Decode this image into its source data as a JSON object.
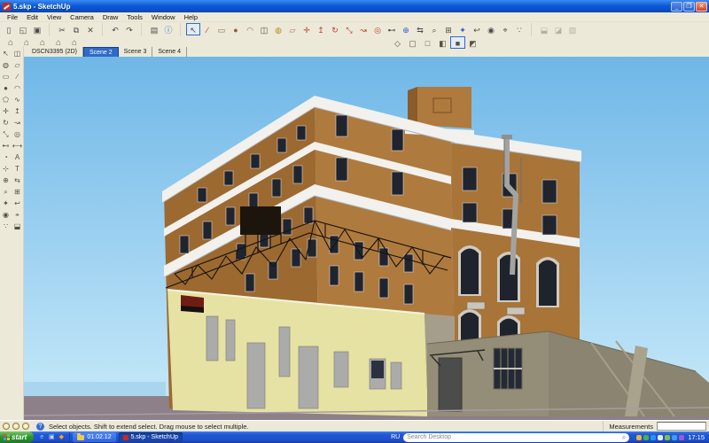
{
  "window": {
    "title": "5.skp - SketchUp",
    "buttons": [
      "minimize",
      "restore",
      "close"
    ]
  },
  "menu": {
    "items": [
      "File",
      "Edit",
      "View",
      "Camera",
      "Draw",
      "Tools",
      "Window",
      "Help"
    ]
  },
  "toolbar_main": {
    "groups": [
      {
        "items": [
          {
            "name": "new",
            "glyph": "▯"
          },
          {
            "name": "open",
            "glyph": "◱"
          },
          {
            "name": "save",
            "glyph": "▣"
          }
        ]
      },
      {
        "items": [
          {
            "name": "cut",
            "glyph": "✂"
          },
          {
            "name": "copy",
            "glyph": "⧉"
          },
          {
            "name": "erase",
            "glyph": "✕"
          }
        ]
      },
      {
        "items": [
          {
            "name": "undo",
            "glyph": "↶"
          },
          {
            "name": "redo",
            "glyph": "↷"
          }
        ]
      },
      {
        "items": [
          {
            "name": "print",
            "glyph": "▤"
          },
          {
            "name": "model-info",
            "glyph": "ⓘ",
            "color": "#2b5fd0"
          }
        ]
      },
      {
        "items": [
          {
            "name": "select",
            "glyph": "↖",
            "pressed": true
          },
          {
            "name": "line",
            "glyph": "∕",
            "color": "#b03020"
          },
          {
            "name": "rectangle",
            "glyph": "▭",
            "color": "#8B5E3C"
          },
          {
            "name": "circle",
            "glyph": "●",
            "color": "#8B5E3C"
          },
          {
            "name": "arc",
            "glyph": "◠",
            "color": "#8B5E3C"
          },
          {
            "name": "make-component",
            "glyph": "◫"
          },
          {
            "name": "paint-bucket",
            "glyph": "◍",
            "color": "#b08a20"
          },
          {
            "name": "eraser",
            "glyph": "▱",
            "color": "#b06a8a"
          },
          {
            "name": "move",
            "glyph": "✛",
            "color": "#c03a2a"
          },
          {
            "name": "push-pull",
            "glyph": "↥",
            "color": "#c03a2a"
          },
          {
            "name": "rotate",
            "glyph": "↻",
            "color": "#c03a2a"
          },
          {
            "name": "scale",
            "glyph": "⤡",
            "color": "#c03a2a"
          },
          {
            "name": "follow-me",
            "glyph": "↝",
            "color": "#c03a2a"
          },
          {
            "name": "offset",
            "glyph": "◎",
            "color": "#c03a2a"
          },
          {
            "name": "tape-measure",
            "glyph": "⊷"
          },
          {
            "name": "orbit",
            "glyph": "⊕",
            "color": "#2b5fd0"
          },
          {
            "name": "pan",
            "glyph": "⇆"
          },
          {
            "name": "zoom",
            "glyph": "⌕"
          },
          {
            "name": "zoom-window",
            "glyph": "⊞"
          },
          {
            "name": "zoom-extents",
            "glyph": "✦",
            "color": "#2b5fd0"
          },
          {
            "name": "previous-view",
            "glyph": "↩"
          },
          {
            "name": "position-camera",
            "glyph": "◉"
          },
          {
            "name": "look-around",
            "glyph": "⌖"
          },
          {
            "name": "walk",
            "glyph": "∵"
          }
        ]
      },
      {
        "items": [
          {
            "name": "section-plane",
            "glyph": "⬓",
            "disabled": true
          },
          {
            "name": "section-cuts",
            "glyph": "◪",
            "disabled": true
          },
          {
            "name": "section-display",
            "glyph": "▨",
            "disabled": true
          }
        ]
      }
    ]
  },
  "toolbar_views": {
    "items": [
      {
        "name": "iso-view",
        "glyph": "⌂"
      },
      {
        "name": "top-view",
        "glyph": "⌂"
      },
      {
        "name": "front-view",
        "glyph": "⌂"
      },
      {
        "name": "right-view",
        "glyph": "⌂"
      },
      {
        "name": "back-view",
        "glyph": "⌂"
      }
    ]
  },
  "toolbar_face_styles": {
    "items": [
      {
        "name": "xray-style",
        "glyph": "◇"
      },
      {
        "name": "wireframe-style",
        "glyph": "▢"
      },
      {
        "name": "hidden-line-style",
        "glyph": "□"
      },
      {
        "name": "shaded-style",
        "glyph": "◧"
      },
      {
        "name": "shaded-textures-style",
        "glyph": "■",
        "pressed": true
      },
      {
        "name": "monochrome-style",
        "glyph": "◩"
      }
    ]
  },
  "scene_tabs": {
    "tabs": [
      {
        "label": "DSCN3395 (2D)",
        "active": false
      },
      {
        "label": "Scene 2",
        "active": true
      },
      {
        "label": "Scene 3",
        "active": false
      },
      {
        "label": "Scene 4",
        "active": false
      }
    ]
  },
  "tool_palette": {
    "rows": [
      [
        {
          "name": "select",
          "glyph": "↖"
        },
        {
          "name": "make-component",
          "glyph": "◫"
        }
      ],
      [
        {
          "name": "paint-bucket",
          "glyph": "◍"
        },
        {
          "name": "eraser",
          "glyph": "▱"
        }
      ],
      [
        {
          "name": "rectangle",
          "glyph": "▭"
        },
        {
          "name": "line",
          "glyph": "∕"
        }
      ],
      [
        {
          "name": "circle",
          "glyph": "●"
        },
        {
          "name": "arc",
          "glyph": "◠"
        }
      ],
      [
        {
          "name": "polygon",
          "glyph": "⬠"
        },
        {
          "name": "freehand",
          "glyph": "∿"
        }
      ],
      [
        {
          "name": "move",
          "glyph": "✛"
        },
        {
          "name": "push-pull",
          "glyph": "↥"
        }
      ],
      [
        {
          "name": "rotate",
          "glyph": "↻"
        },
        {
          "name": "follow-me",
          "glyph": "↝"
        }
      ],
      [
        {
          "name": "scale",
          "glyph": "⤡"
        },
        {
          "name": "offset",
          "glyph": "◎"
        }
      ],
      [
        {
          "name": "tape-measure",
          "glyph": "⊷"
        },
        {
          "name": "dimension",
          "glyph": "⟷"
        }
      ],
      [
        {
          "name": "protractor",
          "glyph": "◔"
        },
        {
          "name": "text",
          "glyph": "A"
        }
      ],
      [
        {
          "name": "axes",
          "glyph": "⊹"
        },
        {
          "name": "3d-text",
          "glyph": "T"
        }
      ],
      [
        {
          "name": "orbit",
          "glyph": "⊕"
        },
        {
          "name": "pan",
          "glyph": "⇆"
        }
      ],
      [
        {
          "name": "zoom",
          "glyph": "⌕"
        },
        {
          "name": "zoom-window",
          "glyph": "⊞"
        }
      ],
      [
        {
          "name": "zoom-extents",
          "glyph": "✦"
        },
        {
          "name": "previous-view",
          "glyph": "↩"
        }
      ],
      [
        {
          "name": "position-camera",
          "glyph": "◉"
        },
        {
          "name": "look-around",
          "glyph": "⌖"
        }
      ],
      [
        {
          "name": "walk",
          "glyph": "∵"
        },
        {
          "name": "section-plane",
          "glyph": "⬓"
        }
      ]
    ]
  },
  "viewport": {
    "description": "3D SketchUp model of a five-story brick building with white cornice bands, pale-yellow ground floor, steel fire-escape canopy, rooftop penthouse, metal flue pipe and low gray concrete annex, against sky and water horizon",
    "colors": {
      "sky_top": "#6FB7E8",
      "sky_bottom": "#C9EAF9",
      "water_left": "#A9D6EE",
      "water_right": "#4C8FCB",
      "ground": "#8D8089",
      "curb": "#A79BA3",
      "brick_left": "#9C6931",
      "brick_mid": "#AF7A3E",
      "brick_right": "#A87438",
      "brick_dark": "#8A5C2B",
      "cornice": "#F2F1ED",
      "cornice_shade": "#AEB4BC",
      "yellow_wall": "#E6E2A3",
      "annex_front": "#948D78",
      "annex_right": "#8B8470",
      "annex_streak": "#A59E89",
      "window_dark": "#20242E",
      "window_trim": "#CFCBC2",
      "gray_panel": "#ABABA9",
      "steel_frame": "#17130E",
      "pipe": "#A3A3A1",
      "awning_red": "#6E1D15",
      "door_dark": "#4C4C4A",
      "corner_strip": "#A59E8C"
    }
  },
  "status_bar": {
    "circle_icons": [
      "geo-location",
      "claim-credit",
      "sign-in"
    ],
    "help_text": "Select objects. Shift to extend select. Drag mouse to select multiple.",
    "measurements_label": "Measurements"
  },
  "taskbar": {
    "start_label": "start",
    "quick_launch": [
      {
        "name": "internet-explorer",
        "glyph": "e",
        "color": "#7fd4ff"
      },
      {
        "name": "desktop",
        "glyph": "▣",
        "color": "#cfd8e8"
      },
      {
        "name": "media-app",
        "glyph": "◆",
        "color": "#f5a623"
      }
    ],
    "buttons": [
      {
        "label": "01.02.12",
        "icon": "folder",
        "active": false
      },
      {
        "label": "5.skp - SketchUp",
        "icon": "sketchup",
        "active": true
      }
    ],
    "language": "RU",
    "search_placeholder": "Search Desktop",
    "tray_icons": [
      {
        "name": "tray-antivirus",
        "color": "#E3B341"
      },
      {
        "name": "tray-messenger",
        "color": "#4CAF50"
      },
      {
        "name": "tray-update",
        "color": "#2196F3"
      },
      {
        "name": "tray-volume",
        "color": "#E8E8E8"
      },
      {
        "name": "tray-network",
        "color": "#7CC142"
      },
      {
        "name": "tray-battery",
        "color": "#3BA0E8"
      },
      {
        "name": "tray-app",
        "color": "#9C5BD0"
      }
    ],
    "clock": "17:15"
  }
}
